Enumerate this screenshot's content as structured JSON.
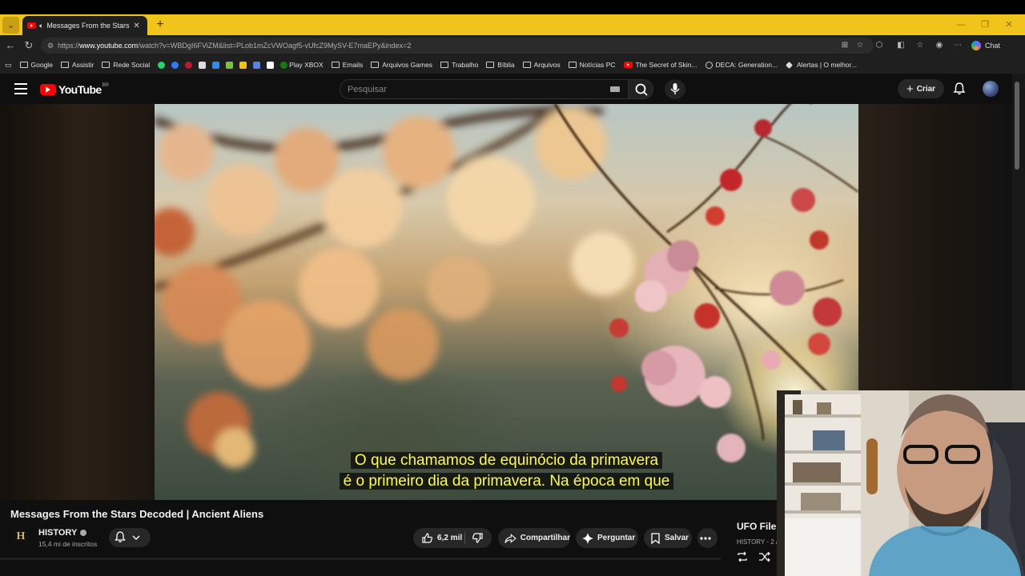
{
  "browser": {
    "tab": {
      "title": "Messages From the Stars Decoded"
    },
    "url_prefix": "https://",
    "url_domain": "www.youtube.com",
    "url_path": "/watch?v=WBDgI6FViZM&list=PLob1mZcVWOagf5-vUfcZ9MySV-E7maEPy&index=2",
    "chat_label": "Chat",
    "bookmarks": [
      {
        "label": "Google",
        "kind": "folder"
      },
      {
        "label": "Assistir",
        "kind": "folder"
      },
      {
        "label": "Rede Social",
        "kind": "folder"
      },
      {
        "label": "Play XBOX",
        "kind": "xbox"
      },
      {
        "label": "Emails",
        "kind": "folder"
      },
      {
        "label": "Arquivos Games",
        "kind": "folder"
      },
      {
        "label": "Trabalho",
        "kind": "folder"
      },
      {
        "label": "Bíblia",
        "kind": "folder"
      },
      {
        "label": "Arquivos",
        "kind": "folder"
      },
      {
        "label": "Notícias PC",
        "kind": "folder"
      },
      {
        "label": "The Secret of Skin...",
        "kind": "youtube"
      },
      {
        "label": "DECA: Generation...",
        "kind": "globe"
      },
      {
        "label": "Alertas | O melhor...",
        "kind": "diamond"
      }
    ]
  },
  "youtube": {
    "logo_text": "YouTube",
    "country": "BR",
    "search_placeholder": "Pesquisar",
    "create_label": "Criar",
    "subtitle_line1": "O que chamamos de equinócio da primavera",
    "subtitle_line2": "é o primeiro dia da primavera.  Na época em que",
    "video_title": "Messages From the Stars Decoded | Ancient Aliens",
    "channel": {
      "name": "HISTORY",
      "logo_letter": "H",
      "subscribers": "15,4 mi de inscritos"
    },
    "actions": {
      "likes": "6,2 mil",
      "share": "Compartilhar",
      "ask": "Perguntar",
      "save": "Salvar"
    },
    "playlist": {
      "title": "UFO File",
      "meta": "HISTORY - 2 /"
    }
  },
  "colors": {
    "brand_red": "#ff0000",
    "tab_bar": "#f0c41b",
    "subtitle": "#ffff3a"
  }
}
